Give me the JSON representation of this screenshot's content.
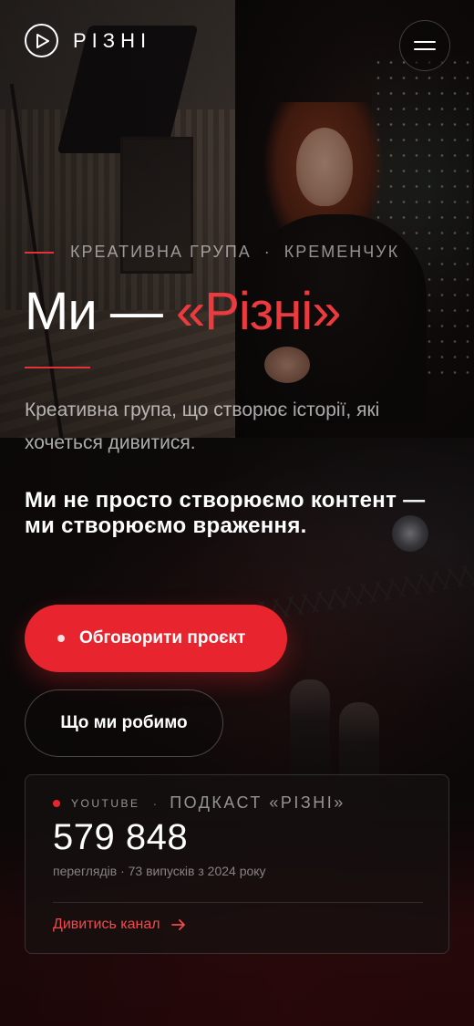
{
  "header": {
    "logo_text": "РІЗНІ",
    "logo_icon": "play-circle-icon",
    "menu_icon": "hamburger-menu-icon"
  },
  "hero": {
    "eyebrow_left": "КРЕАТИВНА ГРУПА",
    "eyebrow_separator": "·",
    "eyebrow_right": "КРЕМЕНЧУК",
    "title_plain": "Ми — ",
    "title_accent": "«Різні»",
    "subtitle": "Креативна група, що створює історії, які хочеться дивитися.",
    "lead": "Ми не просто створюємо контент — ми створюємо враження."
  },
  "actions": {
    "primary_label": "Обговорити проєкт",
    "secondary_label": "Що ми робимо"
  },
  "stats_card": {
    "platform": "YOUTUBE",
    "separator": "·",
    "show_name": "ПОДКАСТ «РІЗНІ»",
    "views": "579 848",
    "meta": "переглядів · 73 випусків з 2024 року",
    "link_label": "Дивитись канал",
    "link_icon": "arrow-right-icon"
  },
  "colors": {
    "accent": "#e8252e",
    "accent_text": "#ec3a3f",
    "background": "#0c0a0b"
  }
}
